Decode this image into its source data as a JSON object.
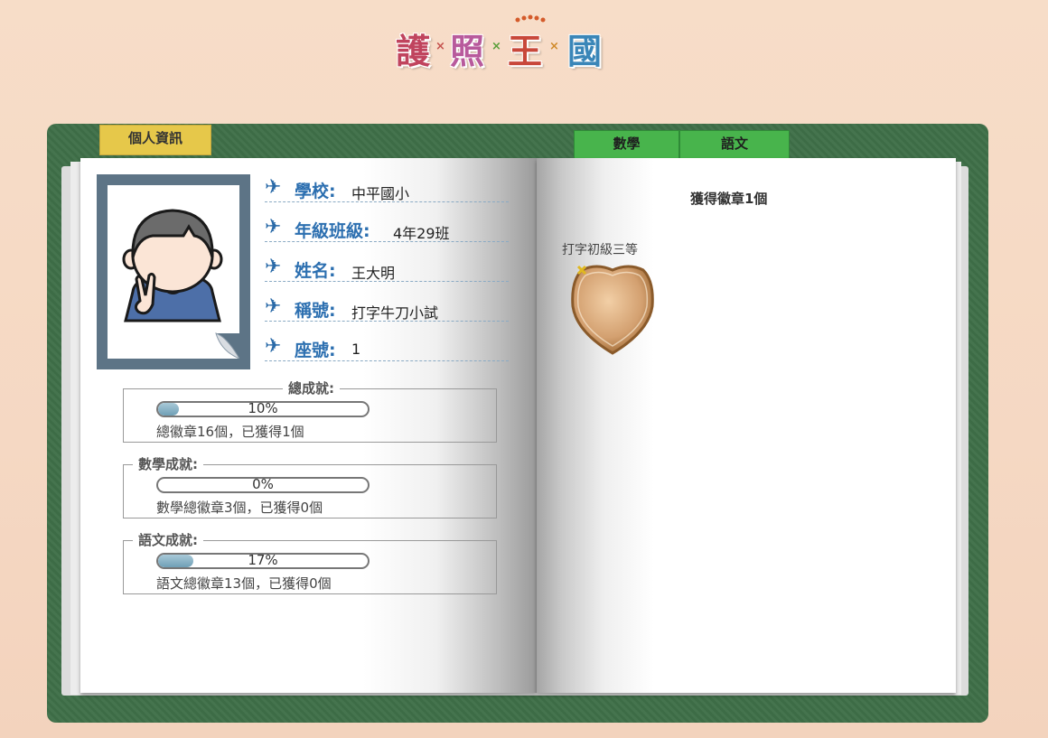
{
  "logo": {
    "chars": [
      "護",
      "照",
      "王",
      "國"
    ]
  },
  "tabs": {
    "personal": "個人資訊",
    "math": "數學",
    "language": "語文"
  },
  "profile": {
    "fields": [
      {
        "label": "學校:",
        "value": "中平國小"
      },
      {
        "label": "年級班級:",
        "value": "4年29班"
      },
      {
        "label": "姓名:",
        "value": "王大明"
      },
      {
        "label": "稱號:",
        "value": "打字牛刀小試"
      },
      {
        "label": "座號:",
        "value": "1"
      }
    ]
  },
  "achievements": {
    "total": {
      "title": "總成就:",
      "percent_text": "10%",
      "percent": 10,
      "note": "總徽章16個，已獲得1個"
    },
    "math": {
      "title": "數學成就:",
      "percent_text": "0%",
      "percent": 0,
      "note": "數學總徽章3個，已獲得0個"
    },
    "language": {
      "title": "語文成就:",
      "percent_text": "17%",
      "percent": 17,
      "note": "語文總徽章13個，已獲得0個"
    }
  },
  "badges": {
    "count_text": "獲得徽章1個",
    "items": [
      {
        "name": "打字初級三等",
        "icon": "shield-badge-icon",
        "color": "#d3a070"
      }
    ]
  },
  "colors": {
    "board": "#3f6f48",
    "tab_personal": "#e6c84a",
    "tab_subject": "#48b44c",
    "label_blue": "#2c6fb0"
  }
}
